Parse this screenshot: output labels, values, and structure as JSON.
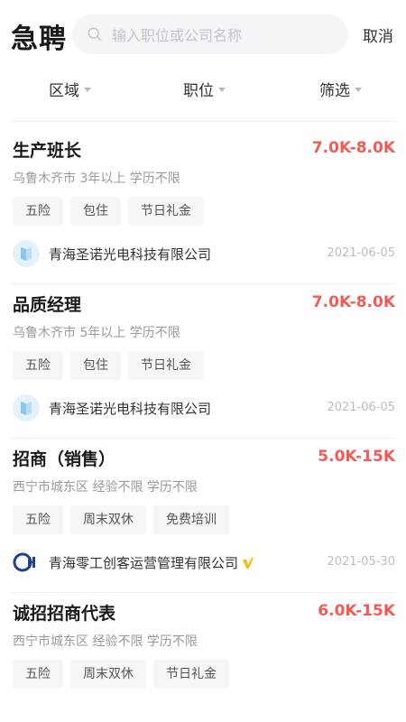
{
  "header": {
    "title": "急聘",
    "search_placeholder": "输入职位或公司名称",
    "cancel_label": "取消"
  },
  "filters": [
    {
      "label": "区域"
    },
    {
      "label": "职位"
    },
    {
      "label": "筛选"
    }
  ],
  "jobs": [
    {
      "title": "生产班长",
      "salary": "7.0K-8.0K",
      "meta": "乌鲁木齐市 3年以上 学历不限",
      "tags": [
        "五险",
        "包住",
        "节日礼金"
      ],
      "company": "青海圣诺光电科技有限公司",
      "date": "2021-06-05"
    },
    {
      "title": "品质经理",
      "salary": "7.0K-8.0K",
      "meta": "乌鲁木齐市 5年以上 学历不限",
      "tags": [
        "五险",
        "包住",
        "节日礼金"
      ],
      "company": "青海圣诺光电科技有限公司",
      "date": "2021-06-05"
    },
    {
      "title": "招商（销售）",
      "salary": "5.0K-15K",
      "meta": "西宁市城东区 经验不限 学历不限",
      "tags": [
        "五险",
        "周末双休",
        "免费培训"
      ],
      "company": "青海零工创客运营管理有限公司",
      "date": "2021-05-30"
    },
    {
      "title": "诚招招商代表",
      "salary": "6.0K-15K",
      "meta": "西宁市城东区 经验不限 学历不限",
      "tags": [
        "五险",
        "周末双休",
        "节日礼金"
      ]
    }
  ],
  "colors": {
    "salary": "#f25a55",
    "verified_badge": "#f5b800",
    "logo_blue": "#8ec7ea",
    "logo_dark": "#1f3f8f"
  }
}
